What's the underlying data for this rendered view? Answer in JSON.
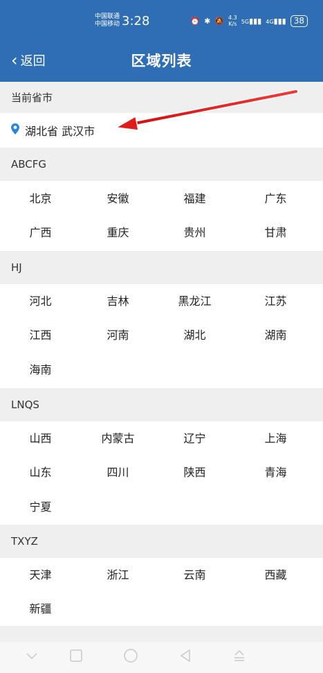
{
  "status": {
    "carrier_top": "中国联通",
    "carrier_bottom": "中国移动",
    "time": "3:28",
    "net_speed_top": "4.3",
    "net_speed_bottom": "K/s",
    "sim1_gen": "5G",
    "sim2_gen": "4G",
    "battery": "38"
  },
  "header": {
    "back_label": "返回",
    "title": "区域列表"
  },
  "current": {
    "section_label": "当前省市",
    "location_text": "湖北省 武汉市"
  },
  "groups": [
    {
      "label": "ABCFG",
      "items": [
        "北京",
        "安徽",
        "福建",
        "广东",
        "广西",
        "重庆",
        "贵州",
        "甘肃"
      ]
    },
    {
      "label": "HJ",
      "items": [
        "河北",
        "吉林",
        "黑龙江",
        "江苏",
        "江西",
        "河南",
        "湖北",
        "湖南",
        "海南"
      ]
    },
    {
      "label": "LNQS",
      "items": [
        "山西",
        "内蒙古",
        "辽宁",
        "上海",
        "山东",
        "四川",
        "陕西",
        "青海",
        "宁夏"
      ]
    },
    {
      "label": "TXYZ",
      "items": [
        "天津",
        "浙江",
        "云南",
        "西藏",
        "新疆"
      ]
    }
  ],
  "colors": {
    "header_bg": "#2f6db5",
    "section_bg": "#efefef",
    "pin": "#2b87d6",
    "arrow": "#e01b1b"
  },
  "icons": [
    "back-chevron-icon",
    "location-pin-icon",
    "alarm-icon",
    "bluetooth-icon",
    "mute-icon",
    "signal-icon",
    "battery-icon",
    "red-arrow-annotation"
  ]
}
